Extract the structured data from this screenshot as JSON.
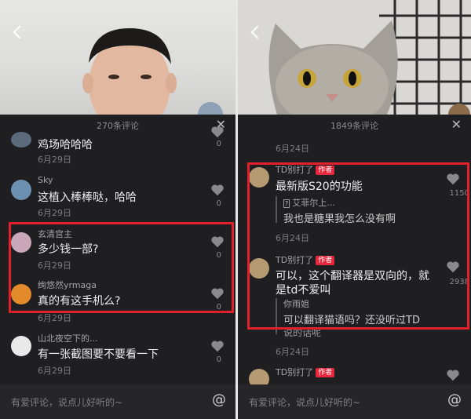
{
  "left": {
    "comment_count": "270条评论",
    "comments": [
      {
        "text": "鸡场哈哈哈",
        "date": "6月29日",
        "likes": "0"
      },
      {
        "user": "Sky",
        "text": "这植入棒棒哒，哈哈",
        "date": "6月29日",
        "likes": "0"
      },
      {
        "user": "玄清宫主",
        "text": "多少钱一部?",
        "date": "6月29日",
        "likes": "0"
      },
      {
        "user": "绚悠然yrmaga",
        "text": "真的有这手机么?",
        "date": "6月29日",
        "likes": "0"
      },
      {
        "user": "山北夜空下的...",
        "text": "有一张截图要不要看一下",
        "date": "6月29日",
        "likes": "0"
      }
    ],
    "input_placeholder": "有爱评论，说点儿好听的~"
  },
  "right": {
    "comment_count": "1849条评论",
    "top_date": "6月24日",
    "comments": [
      {
        "user": "TD别打了",
        "tag": "作者",
        "text": "最新版S20的功能",
        "reply_user": "艾菲尔上...",
        "reply_text": "我也是糖果我怎么没有啊",
        "date": "6月24日",
        "likes": "1150"
      },
      {
        "user": "TD别打了",
        "tag": "作者",
        "text_line1": "可以，这个翻译器是双向的，就",
        "text_line2": "是td不爱叫",
        "reply_user": "你雨姐",
        "reply_text_line1": "可以翻译猫语吗？还没听过TD",
        "reply_text_line2": "说的话呢",
        "date": "6月24日",
        "likes": "2938"
      },
      {
        "user": "TD别打了",
        "tag": "作者"
      }
    ],
    "input_placeholder": "有爱评论，说点儿好听的~"
  },
  "colors": {
    "highlight": "#e1202b",
    "author_tag": "#e5283d",
    "background": "#1f1f21"
  }
}
